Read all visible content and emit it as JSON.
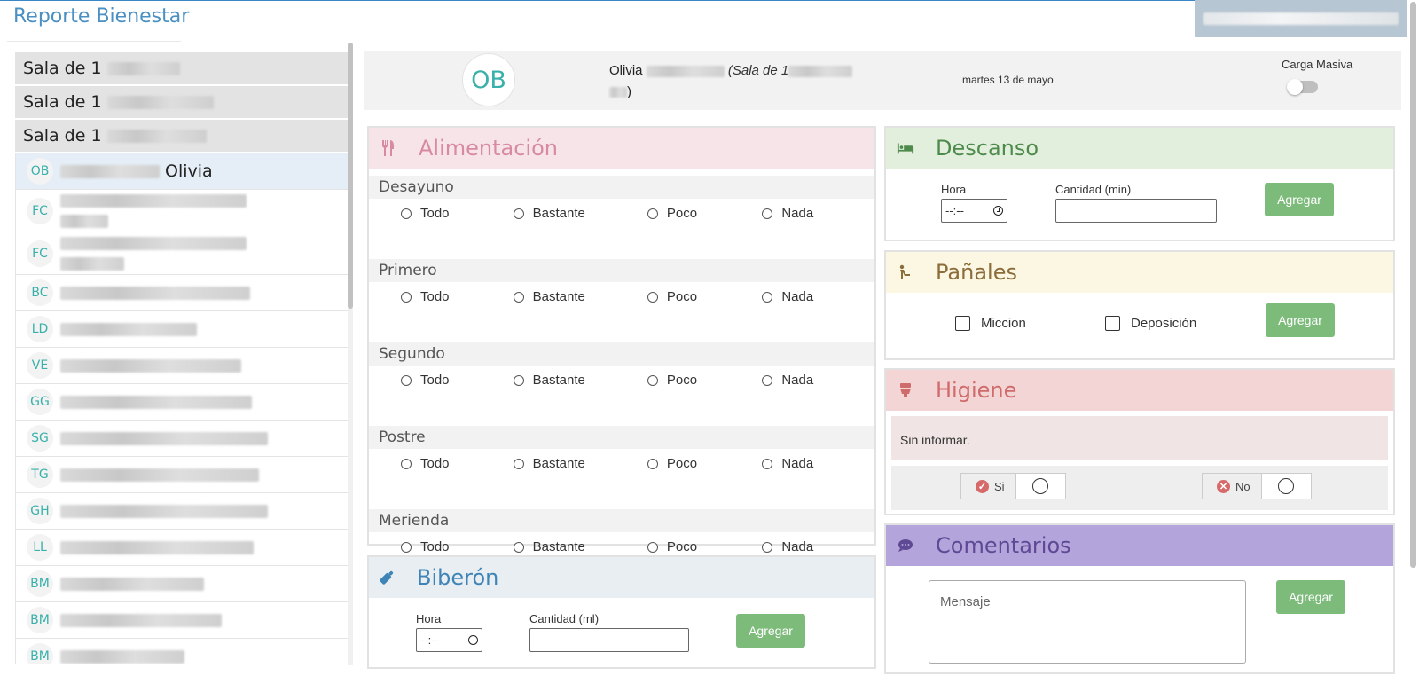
{
  "app": {
    "title": "Reporte Bienestar"
  },
  "sidebar": {
    "groups": [
      {
        "label": "Sala de 1"
      },
      {
        "label": "Sala de 1"
      },
      {
        "label": "Sala de 1"
      }
    ],
    "children": [
      {
        "initials": "OB",
        "name": "Olivia",
        "selected": true
      },
      {
        "initials": "FC",
        "name": ""
      },
      {
        "initials": "FC",
        "name": ""
      },
      {
        "initials": "BC",
        "name": ""
      },
      {
        "initials": "LD",
        "name": ""
      },
      {
        "initials": "VE",
        "name": ""
      },
      {
        "initials": "GG",
        "name": ""
      },
      {
        "initials": "SG",
        "name": ""
      },
      {
        "initials": "TG",
        "name": ""
      },
      {
        "initials": "GH",
        "name": ""
      },
      {
        "initials": "LL",
        "name": ""
      },
      {
        "initials": "BM",
        "name": ""
      },
      {
        "initials": "BM",
        "name": ""
      },
      {
        "initials": "BM",
        "name": ""
      }
    ]
  },
  "header": {
    "avatar_initials": "OB",
    "student_first_name": "Olivia",
    "student_room_prefix": "(Sala de 1",
    "student_room_suffix": ")",
    "date": "martes 13 de mayo",
    "bulk_label": "Carga Masiva"
  },
  "alimentacion": {
    "title": "Alimentación",
    "meals": [
      "Desayuno",
      "Primero",
      "Segundo",
      "Postre",
      "Merienda"
    ],
    "options": [
      "Todo",
      "Bastante",
      "Poco",
      "Nada"
    ]
  },
  "biberon": {
    "title": "Biberón",
    "hora_label": "Hora",
    "hora_value": "--:--",
    "cantidad_label": "Cantidad (ml)",
    "button": "Agregar"
  },
  "descanso": {
    "title": "Descanso",
    "hora_label": "Hora",
    "hora_value": "--:--",
    "cantidad_label": "Cantidad (min)",
    "button": "Agregar"
  },
  "panales": {
    "title": "Pañales",
    "options": [
      "Miccion",
      "Deposición"
    ],
    "button": "Agregar"
  },
  "higiene": {
    "title": "Higiene",
    "status": "Sin informar.",
    "yes_label": "Si",
    "no_label": "No"
  },
  "comentarios": {
    "title": "Comentarios",
    "placeholder": "Mensaje",
    "button": "Agregar"
  },
  "colors": {
    "accent": "#4a90c2",
    "green_button": "#7dbb7b",
    "initials": "#39b0aa"
  }
}
